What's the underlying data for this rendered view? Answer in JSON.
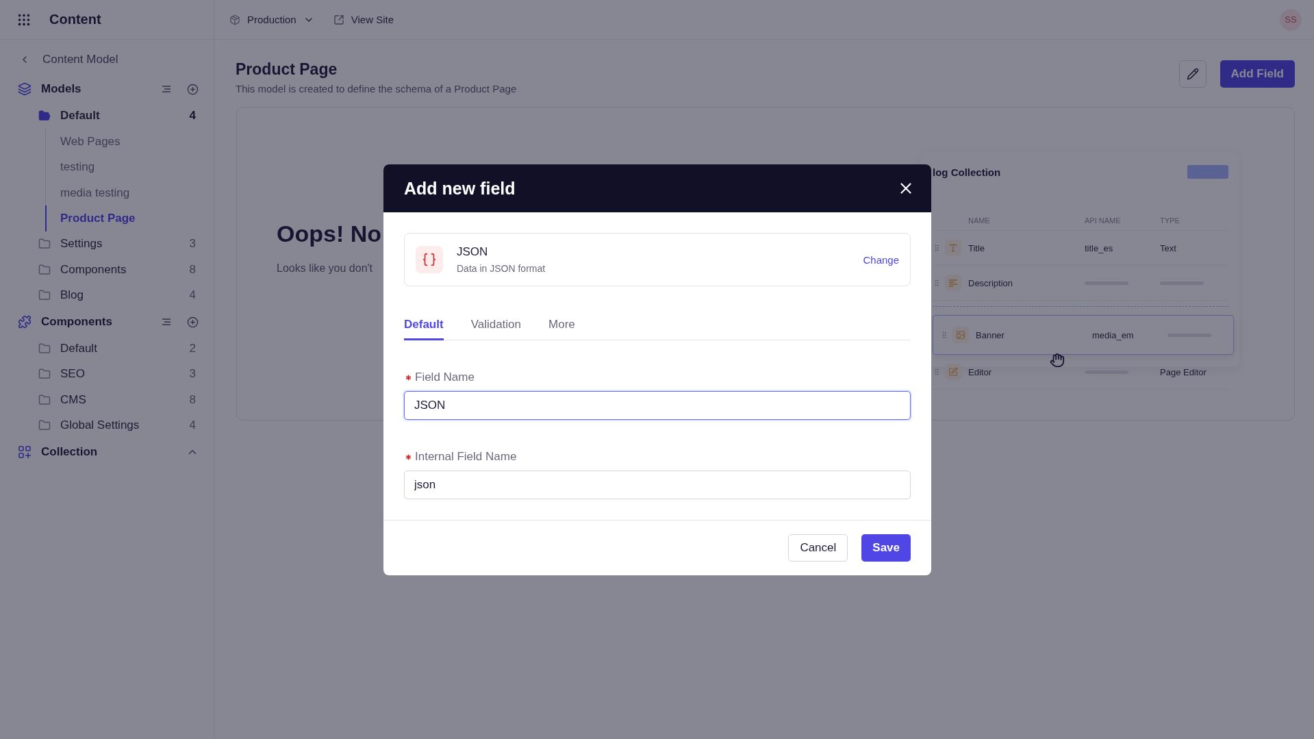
{
  "app": {
    "title": "Content"
  },
  "topbar": {
    "environment": "Production",
    "view_site": "View Site",
    "avatar": "SS"
  },
  "sidebar": {
    "back": "Content Model",
    "sections": [
      {
        "title": "Models",
        "kind": "models",
        "collapsible": false,
        "folders": [
          {
            "label": "Default",
            "count": "4",
            "expanded": true,
            "children": [
              {
                "label": "Web Pages",
                "selected": false
              },
              {
                "label": "testing",
                "selected": false
              },
              {
                "label": "media testing",
                "selected": false
              },
              {
                "label": "Product Page",
                "selected": true
              }
            ]
          },
          {
            "label": "Settings",
            "count": "3",
            "expanded": false
          },
          {
            "label": "Components",
            "count": "8",
            "expanded": false
          },
          {
            "label": "Blog",
            "count": "4",
            "expanded": false
          }
        ]
      },
      {
        "title": "Components",
        "kind": "components",
        "collapsible": false,
        "folders": [
          {
            "label": "Default",
            "count": "2",
            "expanded": false
          },
          {
            "label": "SEO",
            "count": "3",
            "expanded": false
          },
          {
            "label": "CMS",
            "count": "8",
            "expanded": false
          },
          {
            "label": "Global Settings",
            "count": "4",
            "expanded": false
          }
        ]
      },
      {
        "title": "Collection",
        "kind": "collection",
        "collapsible": true
      }
    ]
  },
  "page": {
    "title": "Product Page",
    "description": "This model is created to define the schema of a Product Page",
    "add_field": "Add Field"
  },
  "empty_state": {
    "title": "Oops! No",
    "text": "Looks like you don't"
  },
  "illustration": {
    "title": "log Collection",
    "columns": [
      "NAME",
      "API NAME",
      "TYPE"
    ],
    "rows": [
      {
        "kind": "text",
        "name": "Title",
        "api_name": "title_es",
        "type": "Text",
        "dragging": false
      },
      {
        "kind": "paragraph",
        "name": "Description",
        "dragging": false
      },
      {
        "kind": "media",
        "name": "Banner",
        "api_name": "media_em",
        "dragging": true
      },
      {
        "kind": "editor",
        "name": "Editor",
        "type": "Page Editor",
        "dragging": false
      }
    ]
  },
  "modal": {
    "title": "Add new field",
    "field_type": {
      "name": "JSON",
      "description": "Data in JSON format",
      "change": "Change"
    },
    "tabs": [
      {
        "label": "Default",
        "selected": true
      },
      {
        "label": "Validation",
        "selected": false
      },
      {
        "label": "More",
        "selected": false
      }
    ],
    "fields": [
      {
        "label": "Field Name",
        "value": "JSON",
        "required": true,
        "focused": true
      },
      {
        "label": "Internal Field Name",
        "value": "json",
        "required": true,
        "focused": false
      }
    ],
    "buttons": {
      "cancel": "Cancel",
      "save": "Save"
    }
  }
}
